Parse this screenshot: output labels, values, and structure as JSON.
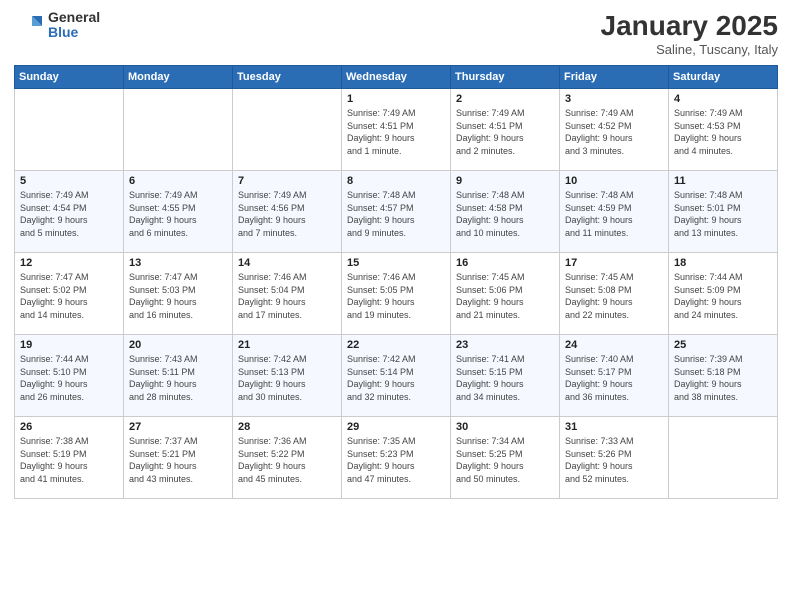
{
  "logo": {
    "general": "General",
    "blue": "Blue"
  },
  "title": "January 2025",
  "location": "Saline, Tuscany, Italy",
  "weekdays": [
    "Sunday",
    "Monday",
    "Tuesday",
    "Wednesday",
    "Thursday",
    "Friday",
    "Saturday"
  ],
  "weeks": [
    [
      {
        "day": "",
        "info": ""
      },
      {
        "day": "",
        "info": ""
      },
      {
        "day": "",
        "info": ""
      },
      {
        "day": "1",
        "info": "Sunrise: 7:49 AM\nSunset: 4:51 PM\nDaylight: 9 hours\nand 1 minute."
      },
      {
        "day": "2",
        "info": "Sunrise: 7:49 AM\nSunset: 4:51 PM\nDaylight: 9 hours\nand 2 minutes."
      },
      {
        "day": "3",
        "info": "Sunrise: 7:49 AM\nSunset: 4:52 PM\nDaylight: 9 hours\nand 3 minutes."
      },
      {
        "day": "4",
        "info": "Sunrise: 7:49 AM\nSunset: 4:53 PM\nDaylight: 9 hours\nand 4 minutes."
      }
    ],
    [
      {
        "day": "5",
        "info": "Sunrise: 7:49 AM\nSunset: 4:54 PM\nDaylight: 9 hours\nand 5 minutes."
      },
      {
        "day": "6",
        "info": "Sunrise: 7:49 AM\nSunset: 4:55 PM\nDaylight: 9 hours\nand 6 minutes."
      },
      {
        "day": "7",
        "info": "Sunrise: 7:49 AM\nSunset: 4:56 PM\nDaylight: 9 hours\nand 7 minutes."
      },
      {
        "day": "8",
        "info": "Sunrise: 7:48 AM\nSunset: 4:57 PM\nDaylight: 9 hours\nand 9 minutes."
      },
      {
        "day": "9",
        "info": "Sunrise: 7:48 AM\nSunset: 4:58 PM\nDaylight: 9 hours\nand 10 minutes."
      },
      {
        "day": "10",
        "info": "Sunrise: 7:48 AM\nSunset: 4:59 PM\nDaylight: 9 hours\nand 11 minutes."
      },
      {
        "day": "11",
        "info": "Sunrise: 7:48 AM\nSunset: 5:01 PM\nDaylight: 9 hours\nand 13 minutes."
      }
    ],
    [
      {
        "day": "12",
        "info": "Sunrise: 7:47 AM\nSunset: 5:02 PM\nDaylight: 9 hours\nand 14 minutes."
      },
      {
        "day": "13",
        "info": "Sunrise: 7:47 AM\nSunset: 5:03 PM\nDaylight: 9 hours\nand 16 minutes."
      },
      {
        "day": "14",
        "info": "Sunrise: 7:46 AM\nSunset: 5:04 PM\nDaylight: 9 hours\nand 17 minutes."
      },
      {
        "day": "15",
        "info": "Sunrise: 7:46 AM\nSunset: 5:05 PM\nDaylight: 9 hours\nand 19 minutes."
      },
      {
        "day": "16",
        "info": "Sunrise: 7:45 AM\nSunset: 5:06 PM\nDaylight: 9 hours\nand 21 minutes."
      },
      {
        "day": "17",
        "info": "Sunrise: 7:45 AM\nSunset: 5:08 PM\nDaylight: 9 hours\nand 22 minutes."
      },
      {
        "day": "18",
        "info": "Sunrise: 7:44 AM\nSunset: 5:09 PM\nDaylight: 9 hours\nand 24 minutes."
      }
    ],
    [
      {
        "day": "19",
        "info": "Sunrise: 7:44 AM\nSunset: 5:10 PM\nDaylight: 9 hours\nand 26 minutes."
      },
      {
        "day": "20",
        "info": "Sunrise: 7:43 AM\nSunset: 5:11 PM\nDaylight: 9 hours\nand 28 minutes."
      },
      {
        "day": "21",
        "info": "Sunrise: 7:42 AM\nSunset: 5:13 PM\nDaylight: 9 hours\nand 30 minutes."
      },
      {
        "day": "22",
        "info": "Sunrise: 7:42 AM\nSunset: 5:14 PM\nDaylight: 9 hours\nand 32 minutes."
      },
      {
        "day": "23",
        "info": "Sunrise: 7:41 AM\nSunset: 5:15 PM\nDaylight: 9 hours\nand 34 minutes."
      },
      {
        "day": "24",
        "info": "Sunrise: 7:40 AM\nSunset: 5:17 PM\nDaylight: 9 hours\nand 36 minutes."
      },
      {
        "day": "25",
        "info": "Sunrise: 7:39 AM\nSunset: 5:18 PM\nDaylight: 9 hours\nand 38 minutes."
      }
    ],
    [
      {
        "day": "26",
        "info": "Sunrise: 7:38 AM\nSunset: 5:19 PM\nDaylight: 9 hours\nand 41 minutes."
      },
      {
        "day": "27",
        "info": "Sunrise: 7:37 AM\nSunset: 5:21 PM\nDaylight: 9 hours\nand 43 minutes."
      },
      {
        "day": "28",
        "info": "Sunrise: 7:36 AM\nSunset: 5:22 PM\nDaylight: 9 hours\nand 45 minutes."
      },
      {
        "day": "29",
        "info": "Sunrise: 7:35 AM\nSunset: 5:23 PM\nDaylight: 9 hours\nand 47 minutes."
      },
      {
        "day": "30",
        "info": "Sunrise: 7:34 AM\nSunset: 5:25 PM\nDaylight: 9 hours\nand 50 minutes."
      },
      {
        "day": "31",
        "info": "Sunrise: 7:33 AM\nSunset: 5:26 PM\nDaylight: 9 hours\nand 52 minutes."
      },
      {
        "day": "",
        "info": ""
      }
    ]
  ]
}
